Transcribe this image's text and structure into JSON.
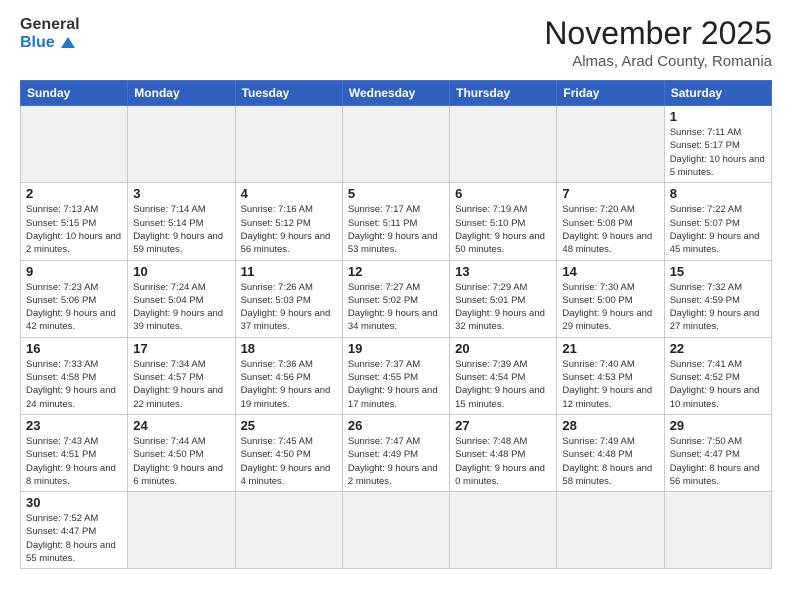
{
  "header": {
    "logo": {
      "line1": "General",
      "line2": "Blue"
    },
    "title": "November 2025",
    "subtitle": "Almas, Arad County, Romania"
  },
  "weekdays": [
    "Sunday",
    "Monday",
    "Tuesday",
    "Wednesday",
    "Thursday",
    "Friday",
    "Saturday"
  ],
  "days": [
    {
      "date": "",
      "info": ""
    },
    {
      "date": "",
      "info": ""
    },
    {
      "date": "",
      "info": ""
    },
    {
      "date": "",
      "info": ""
    },
    {
      "date": "",
      "info": ""
    },
    {
      "date": "",
      "info": ""
    },
    {
      "date": "1",
      "info": "Sunrise: 7:11 AM\nSunset: 5:17 PM\nDaylight: 10 hours\nand 5 minutes."
    },
    {
      "date": "2",
      "info": "Sunrise: 7:13 AM\nSunset: 5:15 PM\nDaylight: 10 hours\nand 2 minutes."
    },
    {
      "date": "3",
      "info": "Sunrise: 7:14 AM\nSunset: 5:14 PM\nDaylight: 9 hours\nand 59 minutes."
    },
    {
      "date": "4",
      "info": "Sunrise: 7:16 AM\nSunset: 5:12 PM\nDaylight: 9 hours\nand 56 minutes."
    },
    {
      "date": "5",
      "info": "Sunrise: 7:17 AM\nSunset: 5:11 PM\nDaylight: 9 hours\nand 53 minutes."
    },
    {
      "date": "6",
      "info": "Sunrise: 7:19 AM\nSunset: 5:10 PM\nDaylight: 9 hours\nand 50 minutes."
    },
    {
      "date": "7",
      "info": "Sunrise: 7:20 AM\nSunset: 5:08 PM\nDaylight: 9 hours\nand 48 minutes."
    },
    {
      "date": "8",
      "info": "Sunrise: 7:22 AM\nSunset: 5:07 PM\nDaylight: 9 hours\nand 45 minutes."
    },
    {
      "date": "9",
      "info": "Sunrise: 7:23 AM\nSunset: 5:06 PM\nDaylight: 9 hours\nand 42 minutes."
    },
    {
      "date": "10",
      "info": "Sunrise: 7:24 AM\nSunset: 5:04 PM\nDaylight: 9 hours\nand 39 minutes."
    },
    {
      "date": "11",
      "info": "Sunrise: 7:26 AM\nSunset: 5:03 PM\nDaylight: 9 hours\nand 37 minutes."
    },
    {
      "date": "12",
      "info": "Sunrise: 7:27 AM\nSunset: 5:02 PM\nDaylight: 9 hours\nand 34 minutes."
    },
    {
      "date": "13",
      "info": "Sunrise: 7:29 AM\nSunset: 5:01 PM\nDaylight: 9 hours\nand 32 minutes."
    },
    {
      "date": "14",
      "info": "Sunrise: 7:30 AM\nSunset: 5:00 PM\nDaylight: 9 hours\nand 29 minutes."
    },
    {
      "date": "15",
      "info": "Sunrise: 7:32 AM\nSunset: 4:59 PM\nDaylight: 9 hours\nand 27 minutes."
    },
    {
      "date": "16",
      "info": "Sunrise: 7:33 AM\nSunset: 4:58 PM\nDaylight: 9 hours\nand 24 minutes."
    },
    {
      "date": "17",
      "info": "Sunrise: 7:34 AM\nSunset: 4:57 PM\nDaylight: 9 hours\nand 22 minutes."
    },
    {
      "date": "18",
      "info": "Sunrise: 7:36 AM\nSunset: 4:56 PM\nDaylight: 9 hours\nand 19 minutes."
    },
    {
      "date": "19",
      "info": "Sunrise: 7:37 AM\nSunset: 4:55 PM\nDaylight: 9 hours\nand 17 minutes."
    },
    {
      "date": "20",
      "info": "Sunrise: 7:39 AM\nSunset: 4:54 PM\nDaylight: 9 hours\nand 15 minutes."
    },
    {
      "date": "21",
      "info": "Sunrise: 7:40 AM\nSunset: 4:53 PM\nDaylight: 9 hours\nand 12 minutes."
    },
    {
      "date": "22",
      "info": "Sunrise: 7:41 AM\nSunset: 4:52 PM\nDaylight: 9 hours\nand 10 minutes."
    },
    {
      "date": "23",
      "info": "Sunrise: 7:43 AM\nSunset: 4:51 PM\nDaylight: 9 hours\nand 8 minutes."
    },
    {
      "date": "24",
      "info": "Sunrise: 7:44 AM\nSunset: 4:50 PM\nDaylight: 9 hours\nand 6 minutes."
    },
    {
      "date": "25",
      "info": "Sunrise: 7:45 AM\nSunset: 4:50 PM\nDaylight: 9 hours\nand 4 minutes."
    },
    {
      "date": "26",
      "info": "Sunrise: 7:47 AM\nSunset: 4:49 PM\nDaylight: 9 hours\nand 2 minutes."
    },
    {
      "date": "27",
      "info": "Sunrise: 7:48 AM\nSunset: 4:48 PM\nDaylight: 9 hours\nand 0 minutes."
    },
    {
      "date": "28",
      "info": "Sunrise: 7:49 AM\nSunset: 4:48 PM\nDaylight: 8 hours\nand 58 minutes."
    },
    {
      "date": "29",
      "info": "Sunrise: 7:50 AM\nSunset: 4:47 PM\nDaylight: 8 hours\nand 56 minutes."
    },
    {
      "date": "30",
      "info": "Sunrise: 7:52 AM\nSunset: 4:47 PM\nDaylight: 8 hours\nand 55 minutes."
    },
    {
      "date": "",
      "info": ""
    },
    {
      "date": "",
      "info": ""
    },
    {
      "date": "",
      "info": ""
    },
    {
      "date": "",
      "info": ""
    },
    {
      "date": "",
      "info": ""
    },
    {
      "date": "",
      "info": ""
    }
  ]
}
